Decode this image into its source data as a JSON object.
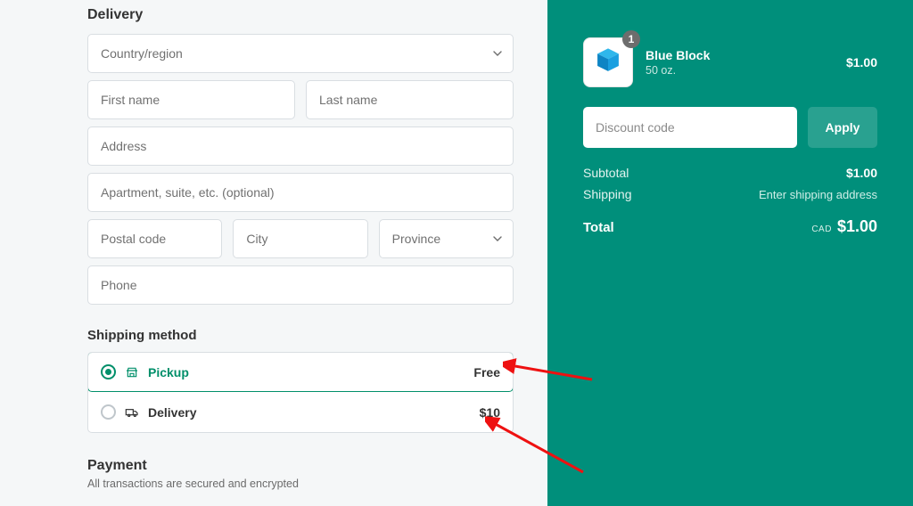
{
  "delivery": {
    "heading": "Delivery",
    "country": {
      "placeholder": "Country/region"
    },
    "first_name": {
      "placeholder": "First name"
    },
    "last_name": {
      "placeholder": "Last name"
    },
    "address": {
      "placeholder": "Address"
    },
    "apartment": {
      "placeholder": "Apartment, suite, etc. (optional)"
    },
    "postal": {
      "placeholder": "Postal code"
    },
    "city": {
      "placeholder": "City"
    },
    "province": {
      "placeholder": "Province"
    },
    "phone": {
      "placeholder": "Phone"
    }
  },
  "shipping": {
    "heading": "Shipping method",
    "options": [
      {
        "label": "Pickup",
        "price": "Free",
        "selected": true,
        "icon": "store"
      },
      {
        "label": "Delivery",
        "price": "$10",
        "selected": false,
        "icon": "truck"
      }
    ]
  },
  "payment": {
    "heading": "Payment",
    "sub": "All transactions are secured and encrypted"
  },
  "cart": {
    "product": {
      "name": "Blue Block",
      "sub": "50 oz.",
      "price": "$1.00",
      "qty": "1"
    },
    "discount": {
      "placeholder": "Discount code",
      "apply": "Apply"
    },
    "subtotal": {
      "label": "Subtotal",
      "value": "$1.00"
    },
    "shipping": {
      "label": "Shipping",
      "value": "Enter shipping address"
    },
    "total": {
      "label": "Total",
      "currency": "CAD",
      "value": "$1.00"
    }
  },
  "colors": {
    "accent": "#008f7b"
  }
}
